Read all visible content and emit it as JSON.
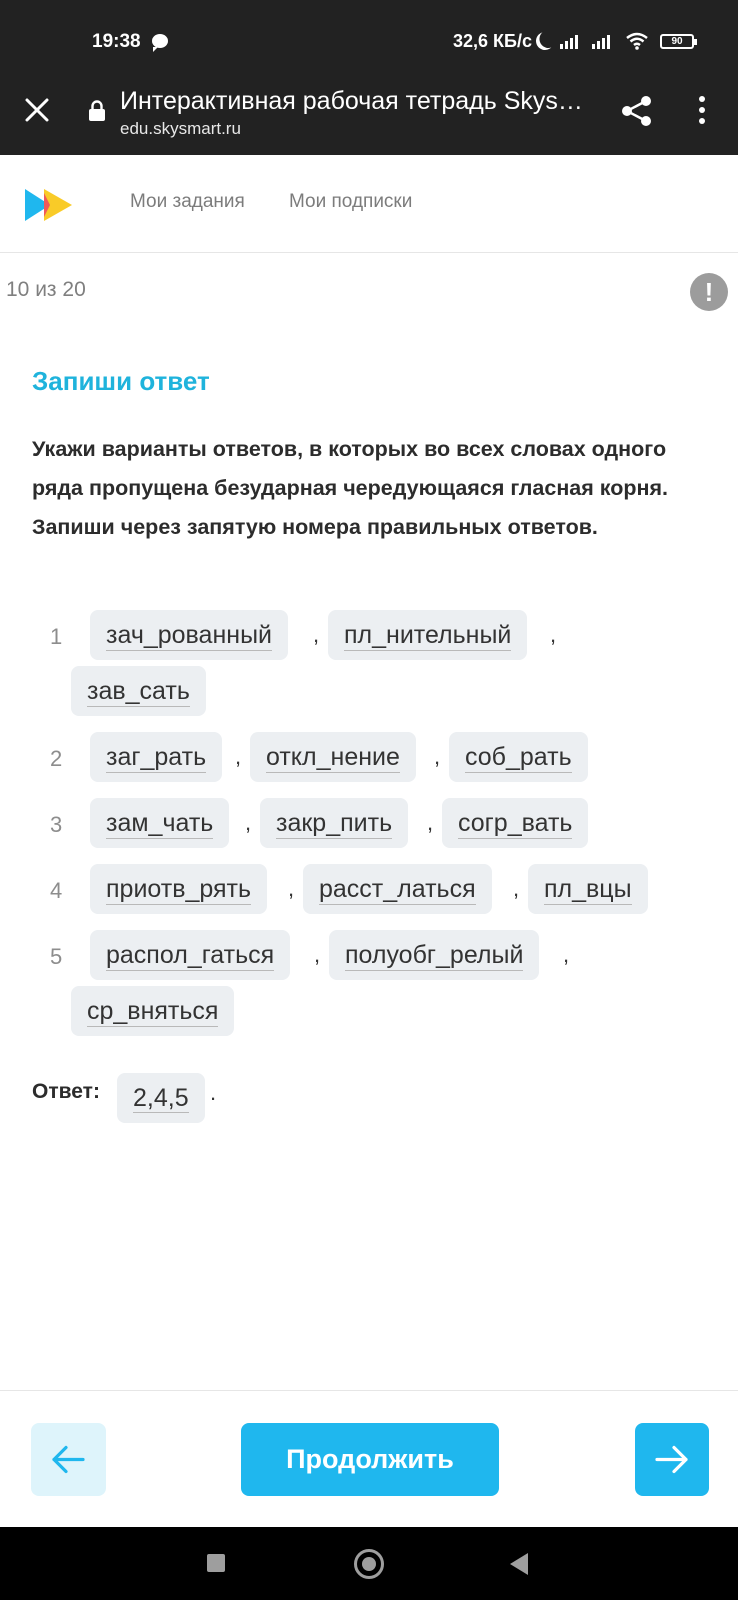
{
  "status_bar": {
    "time": "19:38",
    "speed": "32,6 КБ/с",
    "battery": "90"
  },
  "browser": {
    "tab_title": "Интерактивная рабочая тетрадь Skys…",
    "url": "edu.skysmart.ru",
    "icons": [
      "close-icon",
      "lock-icon",
      "share-icon",
      "more-vert-icon"
    ]
  },
  "site_nav": {
    "my_tasks": "Мои задания",
    "my_subscriptions": "Мои подписки"
  },
  "progress": "10 из 20",
  "task": {
    "heading": "Запиши ответ",
    "text": "Укажи варианты ответов, в которых во всех словах одного ряда пропущена безударная чередующаяся гласная корня. Запиши через запятую номера правильных ответов.",
    "options": [
      {
        "num": "1",
        "words": [
          "зач_рованный",
          "пл_нительный",
          "зав_сать"
        ]
      },
      {
        "num": "2",
        "words": [
          "заг_рать",
          "откл_нение",
          "соб_рать"
        ]
      },
      {
        "num": "3",
        "words": [
          "зам_чать",
          "закр_пить",
          "согр_вать"
        ]
      },
      {
        "num": "4",
        "words": [
          "приотв_рять",
          "расст_латься",
          "пл_вцы"
        ]
      },
      {
        "num": "5",
        "words": [
          "распол_гаться",
          "полуобг_релый",
          "ср_вняться"
        ]
      }
    ],
    "separator": ",",
    "answer_label": "Ответ:",
    "answer_value": "2,4,5",
    "answer_end": "."
  },
  "footer": {
    "continue": "Продолжить",
    "prev_icon": "arrow-left-icon",
    "next_icon": "arrow-right-icon"
  },
  "colors": {
    "accent": "#1fb7ee",
    "heading": "#1fb3dc",
    "chip_bg": "#eceff2",
    "chrome_bg": "#222222"
  }
}
